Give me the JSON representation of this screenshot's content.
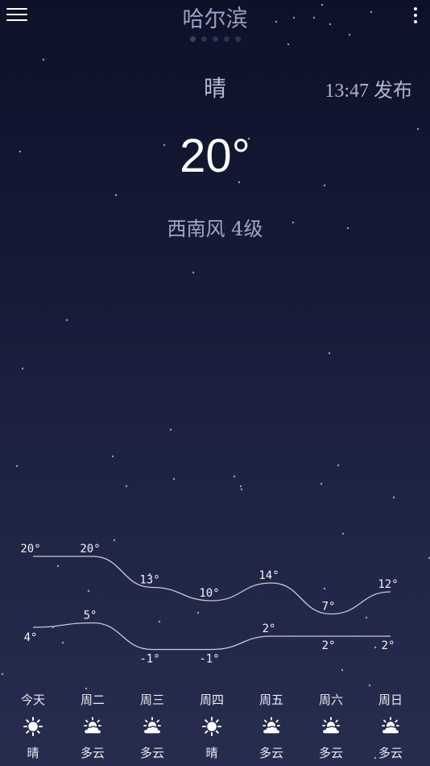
{
  "header": {
    "city": "哈尔滨",
    "page_count": 5,
    "active_page": 0
  },
  "current": {
    "condition": "晴",
    "publish_time": "13:47 发布",
    "temperature": "20°",
    "wind": "西南风 4级"
  },
  "colors": {
    "curve": "#c9cbdb",
    "text": "#ffffff"
  },
  "forecast": [
    {
      "day": "今天",
      "condition": "晴",
      "icon": "sun-icon"
    },
    {
      "day": "周二",
      "condition": "多云",
      "icon": "partly-cloudy-icon"
    },
    {
      "day": "周三",
      "condition": "多云",
      "icon": "partly-cloudy-icon"
    },
    {
      "day": "周四",
      "condition": "晴",
      "icon": "sun-icon"
    },
    {
      "day": "周五",
      "condition": "多云",
      "icon": "partly-cloudy-icon"
    },
    {
      "day": "周六",
      "condition": "多云",
      "icon": "partly-cloudy-icon"
    },
    {
      "day": "周日",
      "condition": "多云",
      "icon": "partly-cloudy-icon"
    }
  ],
  "chart_data": {
    "type": "line",
    "categories": [
      "今天",
      "周二",
      "周三",
      "周四",
      "周五",
      "周六",
      "周日"
    ],
    "series": [
      {
        "values": [
          20,
          20,
          13,
          10,
          14,
          7,
          12
        ],
        "labels": [
          "20°",
          "20°",
          "13°",
          "10°",
          "14°",
          "7°",
          "12°"
        ]
      },
      {
        "values": [
          4,
          5,
          -1,
          -1,
          2,
          2,
          2
        ],
        "labels": [
          "4°",
          "5°",
          "-1°",
          "-1°",
          "2°",
          "2°",
          "2°"
        ]
      }
    ]
  }
}
